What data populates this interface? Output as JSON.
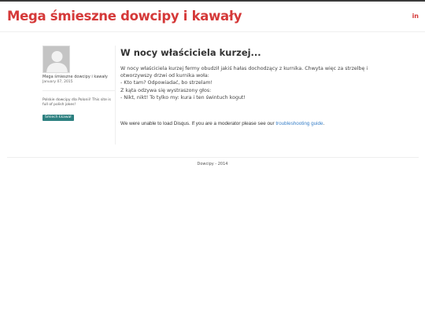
{
  "site": {
    "title": "Mega śmieszne dowcipy i kawały",
    "linkedin_label": "in"
  },
  "sidebar": {
    "author_name": "Mega śmieszne dowcipy i kawały",
    "date": "January 07, 2015",
    "description": "Polskie dowcipy dla Polonii! This site is full of polish jokes!",
    "button_label": "Śmiech Łkawał"
  },
  "post": {
    "title": "W nocy właściciela kurzej...",
    "body_lines": [
      "W nocy właściciela kurzej fermy obudził jakiś hałas dochodzący z kurnika. Chwyta więc za strzelbę i",
      "otworzywszy drzwi od kurnika woła:",
      "- Kto tam? Odpowiadać, bo strzelam!",
      "Z kąta odzywa się wystraszony głos:",
      "- Nikt, nikt! To tylko my: kura i ten świntuch kogut!"
    ]
  },
  "disqus": {
    "message": "We were unable to load Disqus. If you are a moderator please see our ",
    "link_text": "troubleshooting guide",
    "suffix": "."
  },
  "footer": {
    "text": "Dowcipy - 2014"
  },
  "colors": {
    "brand": "#d53939",
    "button": "#2c8080",
    "link": "#3a80c8"
  },
  "icons": {
    "avatar": "default-avatar-icon"
  }
}
